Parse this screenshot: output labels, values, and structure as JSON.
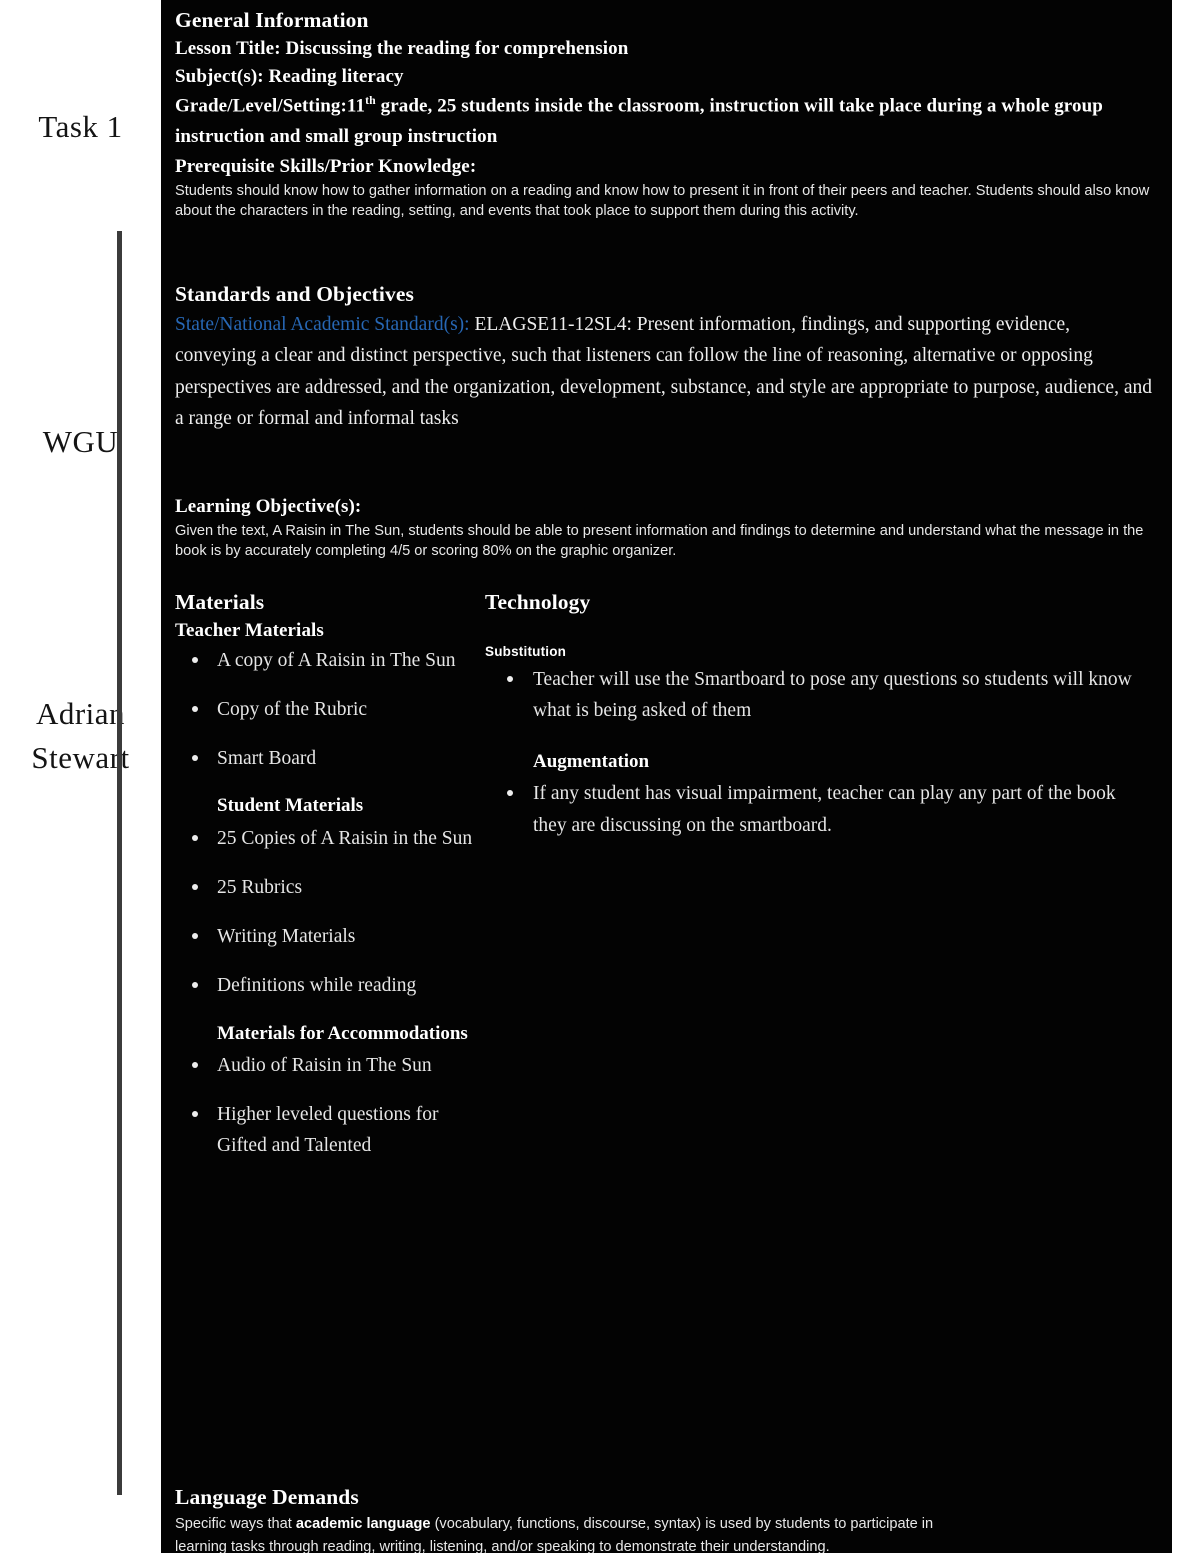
{
  "margin_notes": {
    "task": "Task 1",
    "institution": "WGU",
    "author": "Adrian Stewart"
  },
  "general_information": {
    "heading": "General Information",
    "lesson_title_label": "Lesson Title: ",
    "lesson_title_value": "Discussing the reading for comprehension",
    "subjects_label": "Subject(s): ",
    "subjects_value": "Reading literacy",
    "grade_label": "Grade/Level/Setting:",
    "grade_number": "11",
    "grade_suffix": "th",
    "grade_value": " grade, 25 students inside the classroom, instruction will take place during a whole group instruction and small group instruction",
    "prerequisite_label": "Prerequisite Skills/Prior Knowledge:",
    "prerequisite_text": "Students should know how to gather information on a reading and know how to present it in front of their peers and teacher. Students should also know about the characters in the reading, setting, and events that took place to support them during this activity."
  },
  "standards_and_objectives": {
    "heading": "Standards and Objectives",
    "standard_label": "State/National Academic Standard(s):",
    "standard_text": " ELAGSE11-12SL4: Present information, findings, and supporting evidence, conveying a clear and distinct perspective, such that listeners can follow the line of reasoning, alternative or opposing perspectives are addressed, and the organization, development, substance, and style are appropriate to purpose, audience, and a range or formal and informal tasks",
    "objective_label": "Learning Objective(s):",
    "objective_text": "Given the text, A Raisin in The Sun, students should be able to present information and findings to determine and understand what the message in the book is by accurately completing 4/5 or scoring 80% on the graphic organizer."
  },
  "materials": {
    "heading": "Materials",
    "teacher_heading": "Teacher Materials",
    "teacher_items": [
      "A copy of A Raisin in The Sun",
      "Copy of the Rubric",
      "Smart Board"
    ],
    "student_heading": "Student Materials",
    "student_items": [
      "25 Copies of A Raisin in the Sun",
      "25 Rubrics",
      "Writing Materials",
      "Definitions while reading"
    ],
    "accommodations_heading": "Materials for Accommodations",
    "accommodation_items": [
      "Audio of Raisin in The Sun",
      "Higher leveled questions for Gifted and Talented"
    ]
  },
  "technology": {
    "heading": "Technology",
    "substitution_heading": "Substitution",
    "substitution_items": [
      "Teacher will use the Smartboard to pose any questions so students will know what is being asked of them"
    ],
    "augmentation_heading": "Augmentation",
    "augmentation_items": [
      "If any student has visual impairment, teacher can play any part of the book they are discussing on the smartboard."
    ]
  },
  "language_demands": {
    "heading": "Language Demands",
    "text_part1": "Specific ways that ",
    "text_bold": "academic language",
    "text_part2": " (vocabulary, functions, discourse, syntax) is used by students to participate in",
    "text_line2": "learning tasks through reading, writing, listening, and/or speaking to demonstrate their understanding."
  },
  "colors": {
    "page_background": "#ffffff",
    "document_background": "#030303",
    "document_text": "#f2f2f2",
    "standard_label_blue": "#2767b4",
    "margin_rule": "#3b3b3b"
  }
}
